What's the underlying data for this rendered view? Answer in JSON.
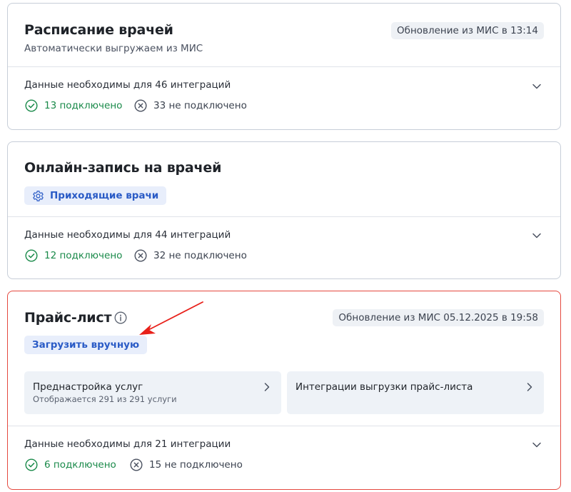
{
  "cards": [
    {
      "title": "Расписание врачей",
      "subtitle": "Автоматически выгружаем из МИС",
      "update": "Обновление из МИС в 13:14",
      "summary": "Данные необходимы для 46 интеграций",
      "connected": "13 подключено",
      "not_connected": "33 не подключено"
    },
    {
      "title": "Онлайн-запись на врачей",
      "button": "Приходящие врачи",
      "summary": "Данные необходимы для 44 интеграций",
      "connected": "12 подключено",
      "not_connected": "32 не подключено"
    },
    {
      "title": "Прайс-лист",
      "update": "Обновление из МИС 05.12.2025 в 19:58",
      "button": "Загрузить вручную",
      "tiles": [
        {
          "title": "Преднастройка услуг",
          "subtitle": "Отображается 291 из 291 услуги"
        },
        {
          "title": "Интеграции выгрузки прайс-листа"
        }
      ],
      "summary": "Данные необходимы для 21 интеграции",
      "connected": "6 подключено",
      "not_connected": "15 не подключено"
    }
  ],
  "colors": {
    "success": "#1a8a4a",
    "accent": "#2a5bc6",
    "highlight_border": "#e5493f",
    "annotation_arrow": "#e8201a"
  },
  "icons": {
    "check": "check-circle-icon",
    "cross": "x-circle-icon",
    "gear": "gear-icon",
    "info": "info-icon",
    "chevron_down": "chevron-down-icon",
    "chevron_right": "chevron-right-icon"
  }
}
